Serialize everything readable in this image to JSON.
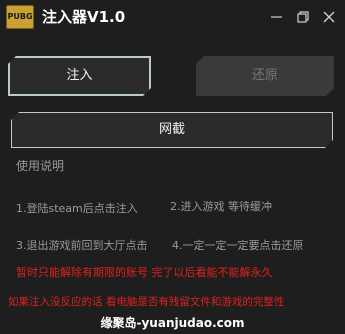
{
  "window": {
    "title": "注入器V1.0",
    "logo_text": "PUBG",
    "logo_color": "#c9a233"
  },
  "controls": {
    "minimize_icon": "minimize-icon",
    "restore_icon": "restore-icon",
    "close_icon": "close-icon"
  },
  "buttons": {
    "inject": "注入",
    "restore": "还原",
    "netcafe": "网截"
  },
  "instructions": {
    "heading": "使用说明",
    "step1": "1.登陆steam后点击注入",
    "step2": "2.进入游戏 等待缓冲",
    "step3": "3.退出游戏前回到大厅点击",
    "step4": "4.一定一定一定要点击还原"
  },
  "warnings": {
    "line1": "暂时只能解除有期限的账号   完了以后看能不能解永久",
    "line2": "如果注入没反应的话 看电脑是否有残留文件和游戏的完整性",
    "color": "#e02020"
  },
  "watermark": "缘聚岛-yuanjudao.com"
}
